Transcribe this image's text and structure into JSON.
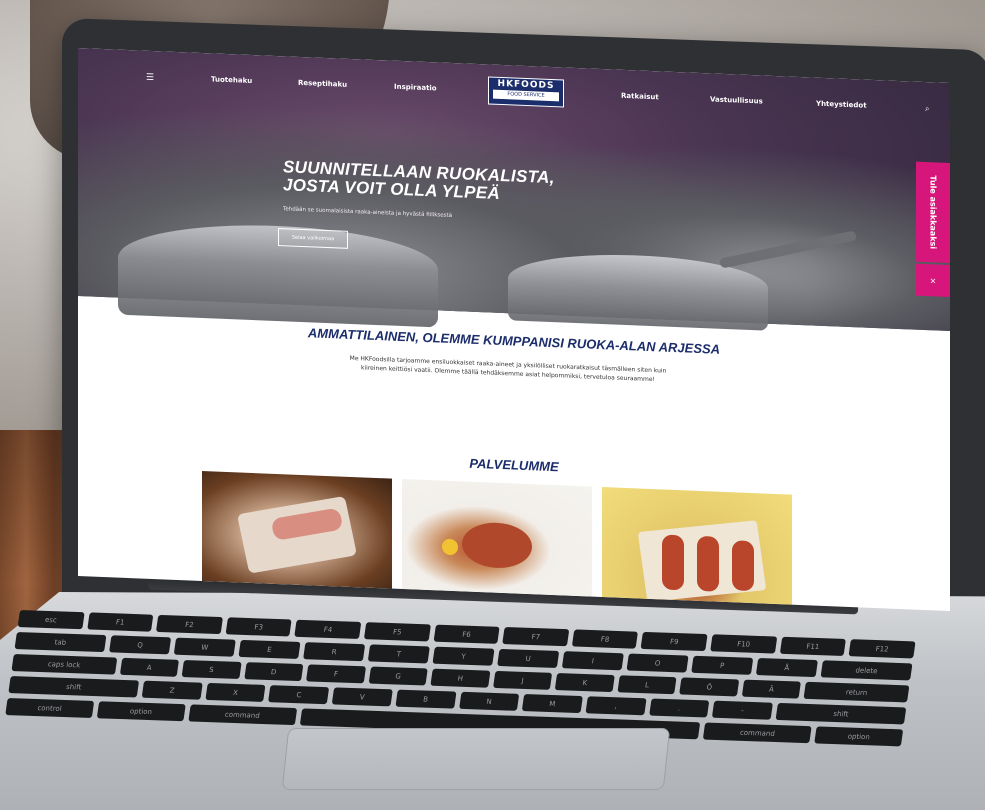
{
  "nav": {
    "menu_icon": "☰",
    "items": [
      "Tuotehaku",
      "Reseptihaku",
      "Inspiraatio",
      "Ratkaisut",
      "Vastuullisuus",
      "Yhteystiedot"
    ],
    "search_icon": "⌕",
    "logo_main": "HKFOODS",
    "logo_sub": "FOOD SERVICE"
  },
  "hero": {
    "title": "SUUNNITELLAAN RUOKALISTA, JOSTA VOIT OLLA YLPEÄ",
    "subtitle": "Tehdään se suomalaisista raaka-aineista ja hyvästä fiiliksestä",
    "button_label": "Selaa valikoimaa"
  },
  "side_cta": {
    "label": "Tule asiakkaaksi",
    "close": "×"
  },
  "intro": {
    "title": "AMMATTILAINEN, OLEMME KUMPPANISI RUOKA-ALAN ARJESSA",
    "text": "Me HKFoodsilla tarjoamme ensiluokkaiset raaka-aineet ja yksilölliset ruokaratkaisut täsmälleen siten kuin kiireinen keittiösi vaatii. Olemme täällä tehdäksemme asiat helpommiksi, tervetuloa seuraamme!"
  },
  "services": {
    "title": "PALVELUMME"
  },
  "keyboard": {
    "row1": [
      "esc",
      "F1",
      "F2",
      "F3",
      "F4",
      "F5",
      "F6",
      "F7",
      "F8",
      "F9",
      "F10",
      "F11",
      "F12"
    ],
    "row2": [
      "tab",
      "Q",
      "W",
      "E",
      "R",
      "T",
      "Y",
      "U",
      "I",
      "O",
      "P",
      "Å",
      "delete"
    ],
    "row3": [
      "caps lock",
      "A",
      "S",
      "D",
      "F",
      "G",
      "H",
      "J",
      "K",
      "L",
      "Ö",
      "Ä",
      "return"
    ],
    "row4": [
      "shift",
      "Z",
      "X",
      "C",
      "V",
      "B",
      "N",
      "M",
      ",",
      ".",
      "-",
      "shift"
    ],
    "row5": [
      "control",
      "option",
      "command",
      "",
      "command",
      "option"
    ]
  },
  "colors": {
    "brand_navy": "#1b2d6b",
    "accent_magenta": "#d7167b"
  }
}
